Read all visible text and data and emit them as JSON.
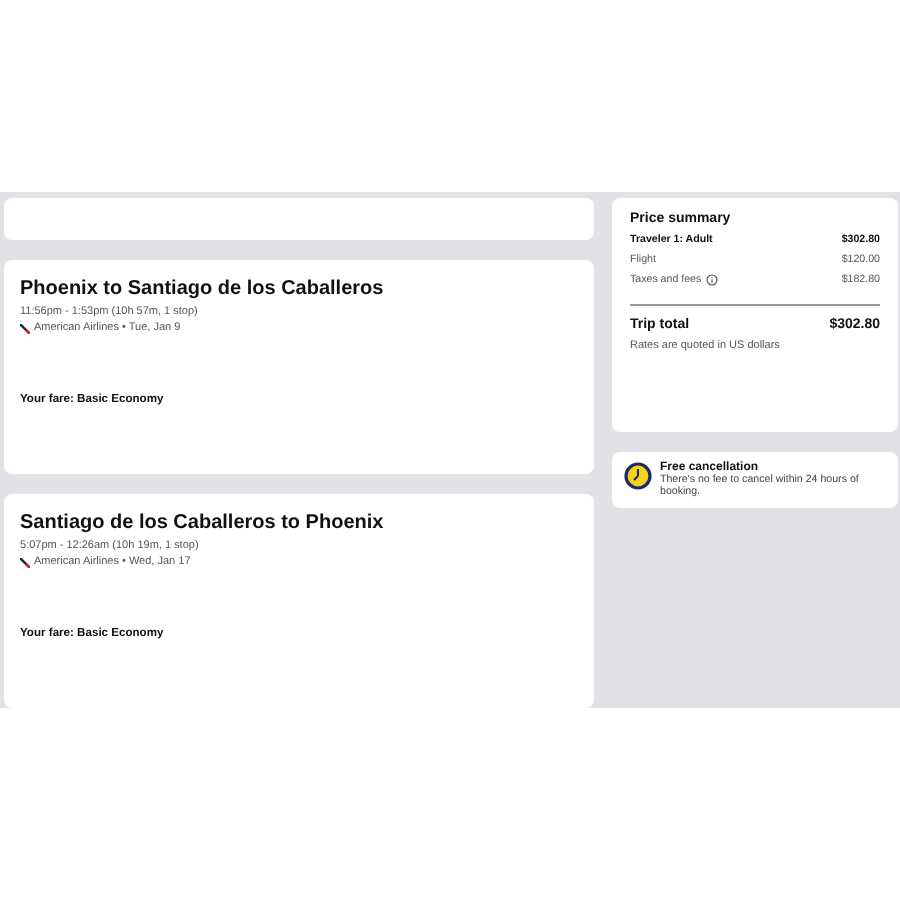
{
  "flights": [
    {
      "title": "Phoenix to Santiago de los Caballeros",
      "times": "11:56pm - 1:53pm (10h 57m, 1 stop)",
      "airline": "American Airlines • Tue, Jan 9",
      "fare": "Your fare: Basic Economy"
    },
    {
      "title": "Santiago de los Caballeros to Phoenix",
      "times": "5:07pm - 12:26am (10h 19m, 1 stop)",
      "airline": "American Airlines • Wed, Jan 17",
      "fare": "Your fare: Basic Economy"
    }
  ],
  "price_summary": {
    "title": "Price summary",
    "rows": [
      {
        "kind": "header",
        "label": "Traveler 1: Adult",
        "amount": "$302.80"
      },
      {
        "kind": "line",
        "label": "Flight",
        "amount": "$120.00"
      },
      {
        "kind": "info",
        "label": "Taxes and fees",
        "amount": "$182.80"
      }
    ],
    "total_label": "Trip total",
    "total": "$302.80",
    "note": "Rates are quoted in US dollars"
  },
  "cancellation": {
    "title": "Free cancellation",
    "text": "There's no fee to cancel within 24 hours of booking."
  }
}
